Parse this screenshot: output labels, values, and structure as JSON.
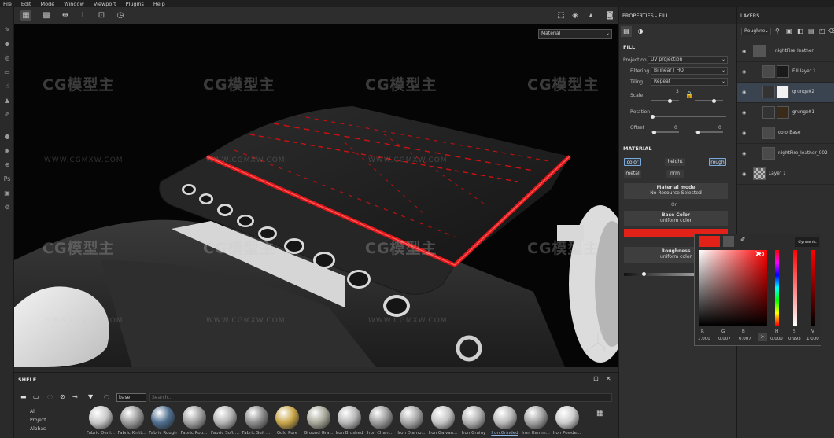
{
  "menu": [
    "File",
    "Edit",
    "Mode",
    "Window",
    "Viewport",
    "Plugins",
    "Help"
  ],
  "viewport": {
    "material_select": "Material",
    "watermark_logo": "CG模型主",
    "watermark_url": "WWW.CGMXW.COM",
    "gizmo_x": "X",
    "gizmo_y": "Y",
    "gizmo_z": "Z"
  },
  "properties": {
    "title": "PROPERTIES - FILL",
    "fill_section": "FILL",
    "projection_label": "Projection",
    "projection_value": "UV projection",
    "filtering_label": "Filtering",
    "filtering_value": "Bilinear | HQ",
    "tiling_label": "Tiling",
    "tiling_value": "Repeat",
    "scale_label": "Scale",
    "scale_value": "3",
    "rotation_label": "Rotation",
    "offset_label": "Offset",
    "offset_x": "0",
    "offset_y": "0",
    "material_section": "MATERIAL",
    "channels": [
      "color",
      "height",
      "rough",
      "metal",
      "nrm"
    ],
    "material_mode_title": "Material mode",
    "material_mode_sub": "No Resource Selected",
    "or_text": "Or",
    "base_color_title": "Base Color",
    "base_color_sub": "uniform color",
    "base_color_hex": "#e22218",
    "roughness_title": "Roughness",
    "roughness_sub": "uniform color"
  },
  "layers": {
    "title": "LAYERS",
    "channel_select": "Roughne",
    "items": [
      {
        "name": "nightFire_leather"
      },
      {
        "name": "Fill layer 1"
      },
      {
        "name": "grunge02"
      },
      {
        "name": "grunge01"
      },
      {
        "name": "colorBase"
      },
      {
        "name": "nightFire_leather_002"
      },
      {
        "name": "Layer 1"
      }
    ]
  },
  "picker": {
    "mode": "dynamic",
    "r_label": "R",
    "g_label": "G",
    "b_label": "B",
    "h_label": "H",
    "s_label": "S",
    "v_label": "V",
    "r": "1.000",
    "g": "0.007",
    "b": "0.007",
    "h": "0.000",
    "s": "0.993",
    "v": "1.000",
    "arrow": ">"
  },
  "shelf": {
    "title": "SHELF",
    "search_value": "base",
    "search_placeholder": "Search...",
    "categories": [
      "All",
      "Project",
      "Alphas"
    ],
    "materials": [
      {
        "name": "Fabric Deni...",
        "color": "#c8c8c8"
      },
      {
        "name": "Fabric Knitt...",
        "color": "#9a9a9a"
      },
      {
        "name": "Fabric Rough",
        "color": "#4f6f8f"
      },
      {
        "name": "Fabric Rou...",
        "color": "#a0a0a0"
      },
      {
        "name": "Fabric Soft ...",
        "color": "#b4b4b4"
      },
      {
        "name": "Fabric Suit ...",
        "color": "#8c8c8c"
      },
      {
        "name": "Gold Pure",
        "color": "#c9a64a"
      },
      {
        "name": "Ground Gra...",
        "color": "#a8a89a"
      },
      {
        "name": "Iron Brushed",
        "color": "#b8b8b8"
      },
      {
        "name": "Iron Chain...",
        "color": "#9c9c9c"
      },
      {
        "name": "Iron Diamo...",
        "color": "#a6a6a6"
      },
      {
        "name": "Iron Galvan...",
        "color": "#c4c4c4"
      },
      {
        "name": "Iron Grainy",
        "color": "#b0b0b0"
      },
      {
        "name": "Iron Grinded",
        "color": "#bababa"
      },
      {
        "name": "Iron Hamm...",
        "color": "#a2a2a2"
      },
      {
        "name": "Iron Powde...",
        "color": "#cdcdcd"
      }
    ]
  }
}
